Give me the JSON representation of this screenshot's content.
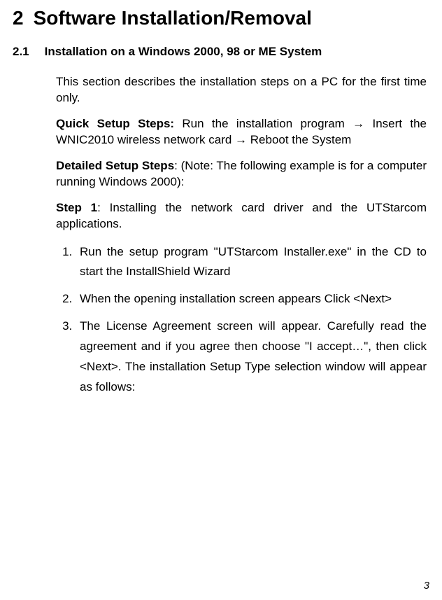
{
  "chapter": {
    "number": "2",
    "title": "Software Installation/Removal"
  },
  "section": {
    "number": "2.1",
    "title": "Installation on a Windows 2000, 98 or ME System"
  },
  "intro": "This section describes the installation steps on a PC for the first time only.",
  "quick_setup": {
    "label": "Quick Setup Steps:",
    "text": " Run the installation program → Insert the WNIC2010 wireless network card → Reboot the System"
  },
  "detailed_setup": {
    "label": "Detailed Setup Steps",
    "text": ": (Note: The following example is for a computer running Windows 2000):"
  },
  "step1": {
    "label": "Step 1",
    "text": ": Installing the network card driver and the UTStarcom applications."
  },
  "list": {
    "item1": "Run the setup program \"UTStarcom Installer.exe\" in the CD to start the InstallShield Wizard",
    "item2": "When the opening installation screen appears Click <Next>",
    "item3": "The License Agreement screen will appear. Carefully read the agreement and if you agree then choose \"I accept…\", then click <Next>. The installation Setup Type selection window will appear as follows:"
  },
  "page_number": "3"
}
